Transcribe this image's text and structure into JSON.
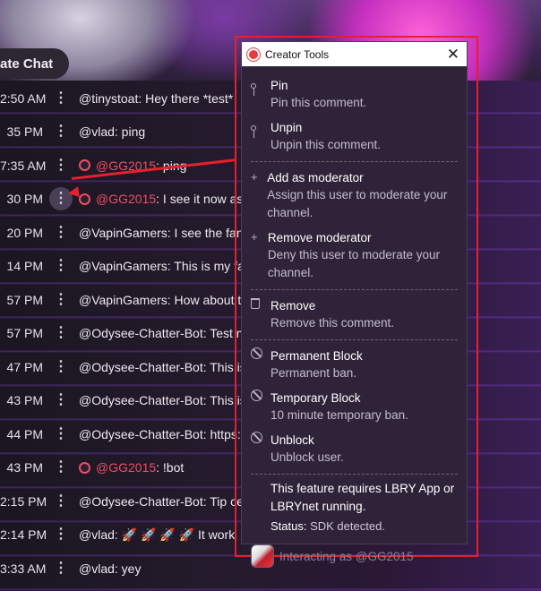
{
  "chat": {
    "title": "ate Chat",
    "rows": [
      {
        "time": "2:50 AM",
        "user": "@tinystoat",
        "text": ": Hey there *test*",
        "mod": false
      },
      {
        "time": "35 PM",
        "user": "@vlad",
        "text": ": ping",
        "mod": false
      },
      {
        "time": "7:35 AM",
        "user": "@GG2015",
        "text": ": ping",
        "mod": true
      },
      {
        "time": "30 PM",
        "user": "@GG2015",
        "text": ": I see it now as",
        "mod": true
      },
      {
        "time": "20 PM",
        "user": "@VapinGamers",
        "text": ": I see the fan",
        "mod": false
      },
      {
        "time": "14 PM",
        "user": "@VapinGamers",
        "text": ": This is my fa",
        "mod": false
      },
      {
        "time": "57 PM",
        "user": "@VapinGamers",
        "text": ": How about th",
        "mod": false
      },
      {
        "time": "57 PM",
        "user": "@Odysee-Chatter-Bot",
        "text": ": Test m",
        "mod": false
      },
      {
        "time": "47 PM",
        "user": "@Odysee-Chatter-Bot",
        "text": ": This is",
        "mod": false
      },
      {
        "time": "43 PM",
        "user": "@Odysee-Chatter-Bot",
        "text": ": This is",
        "mod": false
      },
      {
        "time": "44 PM",
        "user": "@Odysee-Chatter-Bot",
        "text": ": https:",
        "mod": false
      },
      {
        "time": "43 PM",
        "user": "@GG2015",
        "text": ": !bot",
        "mod": true
      },
      {
        "time": "2:15 PM",
        "user": "@Odysee-Chatter-Bot",
        "text": ": Tip ce",
        "mod": false
      },
      {
        "time": "2:14 PM",
        "user": "@vlad",
        "text": ":  🚀  🚀  🚀  🚀  It work",
        "mod": false
      },
      {
        "time": "3:33 AM",
        "user": "@vlad",
        "text": ": yey",
        "mod": false
      }
    ]
  },
  "modal": {
    "title": "Creator Tools",
    "close_glyph": "✕",
    "items": [
      {
        "label": "Pin",
        "desc": "Pin this comment.",
        "icon": "pin-icon"
      },
      {
        "label": "Unpin",
        "desc": "Unpin this comment.",
        "icon": "pin-icon"
      },
      {
        "label": "Add as moderator",
        "desc": "Assign this user to moderate your channel.",
        "icon": "plus-icon"
      },
      {
        "label": "Remove moderator",
        "desc": "Deny this user to moderate your channel.",
        "icon": "plus-icon"
      },
      {
        "label": "Remove",
        "desc": "Remove this comment.",
        "icon": "trash-icon"
      },
      {
        "label": "Permanent Block",
        "desc": "Permanent ban.",
        "icon": "block-icon"
      },
      {
        "label": "Temporary Block",
        "desc": "10 minute temporary ban.",
        "icon": "block-icon"
      },
      {
        "label": "Unblock",
        "desc": "Unblock user.",
        "icon": "block-icon"
      }
    ],
    "info_text": "This feature requires LBRY App or LBRYnet running.",
    "status_label": "Status:",
    "status_value": "SDK detected.",
    "footer_text": "Interacting as @GG2015"
  },
  "colors": {
    "accent_red": "#e5202c",
    "moderator_name": "#f14d66",
    "modal_bg": "#2f2339"
  }
}
